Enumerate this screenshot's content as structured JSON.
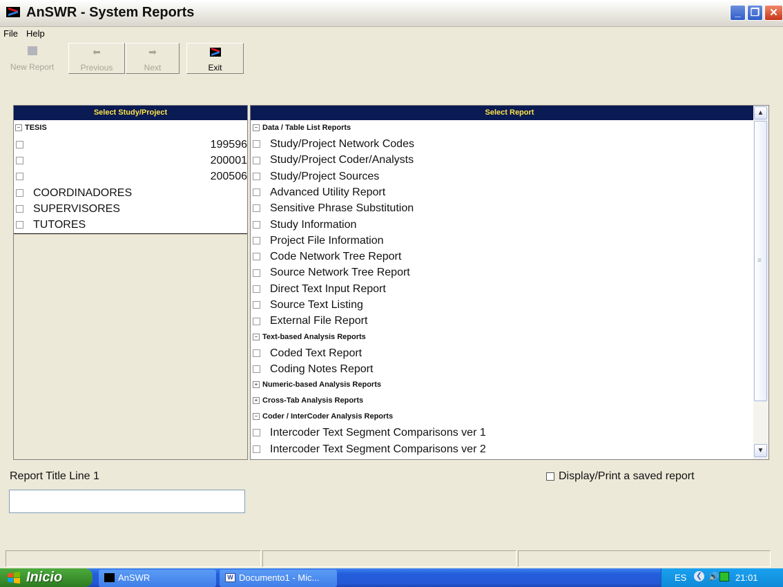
{
  "window": {
    "title": "AnSWR - System Reports"
  },
  "menu": [
    "File",
    "Help"
  ],
  "toolbar": {
    "new_report": "New Report",
    "previous": "Previous",
    "next": "Next",
    "exit": "Exit"
  },
  "left_panel": {
    "header": "Select Study/Project",
    "root": "TESIS",
    "items": [
      {
        "label": "199596"
      },
      {
        "label": "200001"
      },
      {
        "label": "200506"
      },
      {
        "label": "COORDINADORES"
      },
      {
        "label": "SUPERVISORES"
      },
      {
        "label": "TUTORES"
      }
    ]
  },
  "right_panel": {
    "header": "Select Report",
    "groups": [
      {
        "label": "Data / Table List Reports",
        "expanded": true
      },
      {
        "label": "Text-based Analysis Reports",
        "expanded": true
      },
      {
        "label": "Numeric-based Analysis Reports",
        "expanded": false
      },
      {
        "label": "Cross-Tab Analysis Reports",
        "expanded": false
      },
      {
        "label": "Coder / InterCoder Analysis Reports",
        "expanded": true
      }
    ],
    "data_table_items": [
      "Study/Project Network Codes",
      "Study/Project Coder/Analysts",
      "Study/Project Sources",
      "Advanced Utility Report",
      "Sensitive Phrase Substitution",
      "Study Information",
      "Project File Information",
      "Code Network Tree Report",
      "Source Network Tree Report",
      "Direct Text Input Report",
      "Source Text Listing",
      "External File Report"
    ],
    "text_items": [
      "Coded Text Report",
      "Coding Notes Report"
    ],
    "coder_items": [
      "Intercoder Text Segment Comparisons ver 1",
      "Intercoder Text Segment Comparisons ver 2"
    ]
  },
  "report_title_label": "Report Title Line 1",
  "report_title_value": "",
  "saved_report_label": "Display/Print a saved report",
  "taskbar": {
    "start": "Inicio",
    "tasks": [
      "AnSWR",
      "Documento1 - Mic..."
    ],
    "lang": "ES",
    "clock": "21:01"
  }
}
